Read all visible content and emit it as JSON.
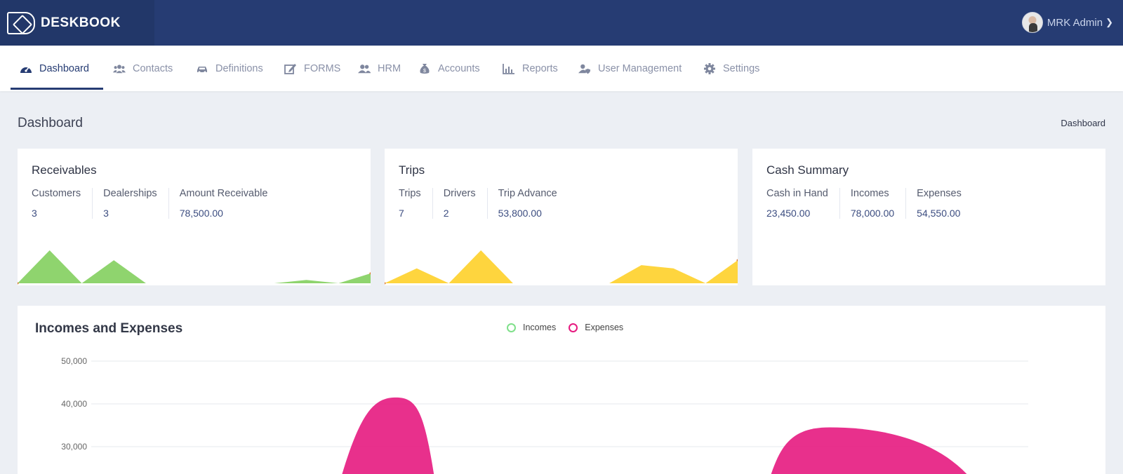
{
  "brand": {
    "name": "DESKBOOK"
  },
  "user": {
    "name": "MRK Admin"
  },
  "nav": {
    "items": [
      {
        "label": "Dashboard",
        "icon": "speedometer-icon"
      },
      {
        "label": "Contacts",
        "icon": "users-icon"
      },
      {
        "label": "Definitions",
        "icon": "car-icon"
      },
      {
        "label": "FORMS",
        "icon": "edit-icon"
      },
      {
        "label": "HRM",
        "icon": "user-group-icon"
      },
      {
        "label": "Accounts",
        "icon": "money-bag-icon"
      },
      {
        "label": "Reports",
        "icon": "bar-chart-icon"
      },
      {
        "label": "User Management",
        "icon": "user-shield-icon"
      },
      {
        "label": "Settings",
        "icon": "gear-icon"
      }
    ]
  },
  "page": {
    "title": "Dashboard",
    "breadcrumb": "Dashboard"
  },
  "cards": {
    "receivables": {
      "title": "Receivables",
      "stats": [
        {
          "label": "Customers",
          "value": "3"
        },
        {
          "label": "Dealerships",
          "value": "3"
        },
        {
          "label": "Amount Receivable",
          "value": "78,500.00"
        }
      ],
      "spark_color": "#8fd46e"
    },
    "trips": {
      "title": "Trips",
      "stats": [
        {
          "label": "Trips",
          "value": "7"
        },
        {
          "label": "Drivers",
          "value": "2"
        },
        {
          "label": "Trip Advance",
          "value": "53,800.00"
        }
      ],
      "spark_color": "#fed53e"
    },
    "cash": {
      "title": "Cash Summary",
      "stats": [
        {
          "label": "Cash in Hand",
          "value": "23,450.00"
        },
        {
          "label": "Incomes",
          "value": "78,000.00"
        },
        {
          "label": "Expenses",
          "value": "54,550.00"
        }
      ]
    }
  },
  "incomes_expenses": {
    "title": "Incomes and Expenses",
    "legend": [
      {
        "label": "Incomes",
        "color": "#7fe08a"
      },
      {
        "label": "Expenses",
        "color": "#e6197f"
      }
    ],
    "y_ticks": [
      "50,000",
      "40,000",
      "30,000"
    ]
  },
  "chart_data": [
    {
      "type": "area",
      "series": [
        {
          "values": [
            0,
            1,
            0,
            0.7,
            0,
            0,
            0,
            0,
            0,
            0.1,
            0,
            0.3
          ]
        }
      ],
      "color": "#8fd46e"
    },
    {
      "type": "area",
      "series": [
        {
          "values": [
            0,
            0.45,
            0,
            1,
            0,
            0,
            0,
            0,
            0.55,
            0.45,
            0,
            0.7
          ]
        }
      ],
      "color": "#fed53e"
    },
    {
      "type": "area",
      "title": "Incomes and Expenses",
      "series": [
        {
          "name": "Incomes",
          "values": []
        },
        {
          "name": "Expenses",
          "peaks": [
            {
              "x_index": 0.33,
              "value": 41500
            },
            {
              "x_index": 0.8,
              "value": 34500
            }
          ]
        }
      ],
      "y_ticks": [
        50000,
        40000,
        30000
      ],
      "grid": true,
      "legend_position": "top-center"
    }
  ]
}
